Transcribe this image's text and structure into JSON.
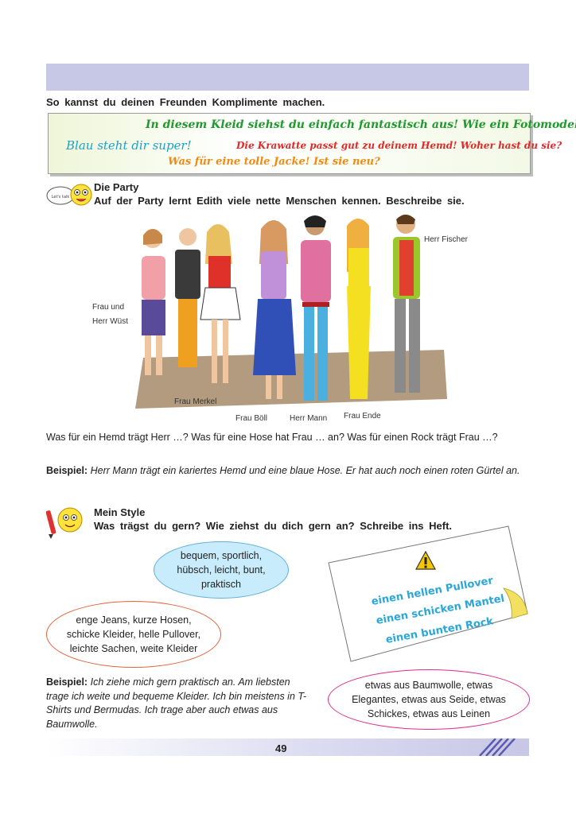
{
  "intro": "So kannst du deinen Freunden Komplimente machen.",
  "compliments": [
    "In diesem Kleid siehst du einfach fantastisch aus! Wie ein Fotomodell!",
    "Blau steht dir super!",
    "Die Krawatte passt gut zu deinem Hemd! Woher hast du sie?",
    "Was für eine tolle Jacke! Ist sie neu?"
  ],
  "section1": {
    "title": "Die Party",
    "instruction": "Auf der Party lernt Edith viele nette Menschen kennen. Beschreibe sie.",
    "icon_caption": "Let's talk",
    "names": {
      "fischer": "Herr Fischer",
      "wuest": "Frau und Herr Wüst",
      "merkel": "Frau Merkel",
      "boell": "Frau Böll",
      "mann": "Herr Mann",
      "ende": "Frau Ende"
    },
    "questions": "Was für ein Hemd trägt Herr …? Was für eine Hose hat Frau … an? Was für einen Rock trägt Frau …?",
    "example_label": "Beispiel:",
    "example_text": "Herr Mann trägt ein kariertes Hemd und eine blaue Hose. Er hat auch noch einen roten Gürtel an."
  },
  "section2": {
    "title": "Mein Style",
    "instruction": "Was trägst du gern? Wie ziehst du dich gern an? Schreibe ins Heft.",
    "bubble_blue": "bequem, sportlich, hübsch, leicht, bunt, praktisch",
    "bubble_red": "enge Jeans, kurze Hosen, schicke Kleider, helle Pullover, leichte Sachen, weite Kleider",
    "bubble_pink": "etwas aus Baumwolle, etwas Elegantes, etwas aus Seide, etwas Schickes, etwas aus Leinen",
    "note_lines": [
      "einen hellen Pullover",
      "einen schicken Mantel",
      "einen bunten Rock"
    ],
    "example_label": "Beispiel:",
    "example_text": "Ich ziehe mich gern praktisch an. Am liebsten trage ich weite und bequeme Kleider. Ich bin meistens in T-Shirts und Bermudas. Ich trage aber auch etwas aus Baumwolle."
  },
  "page_number": "49",
  "colors": {
    "header": "#c7c7e6",
    "green": "#1f9a2c",
    "red": "#e02a2a",
    "orange": "#f08a12",
    "cyan": "#1aa3c9"
  }
}
